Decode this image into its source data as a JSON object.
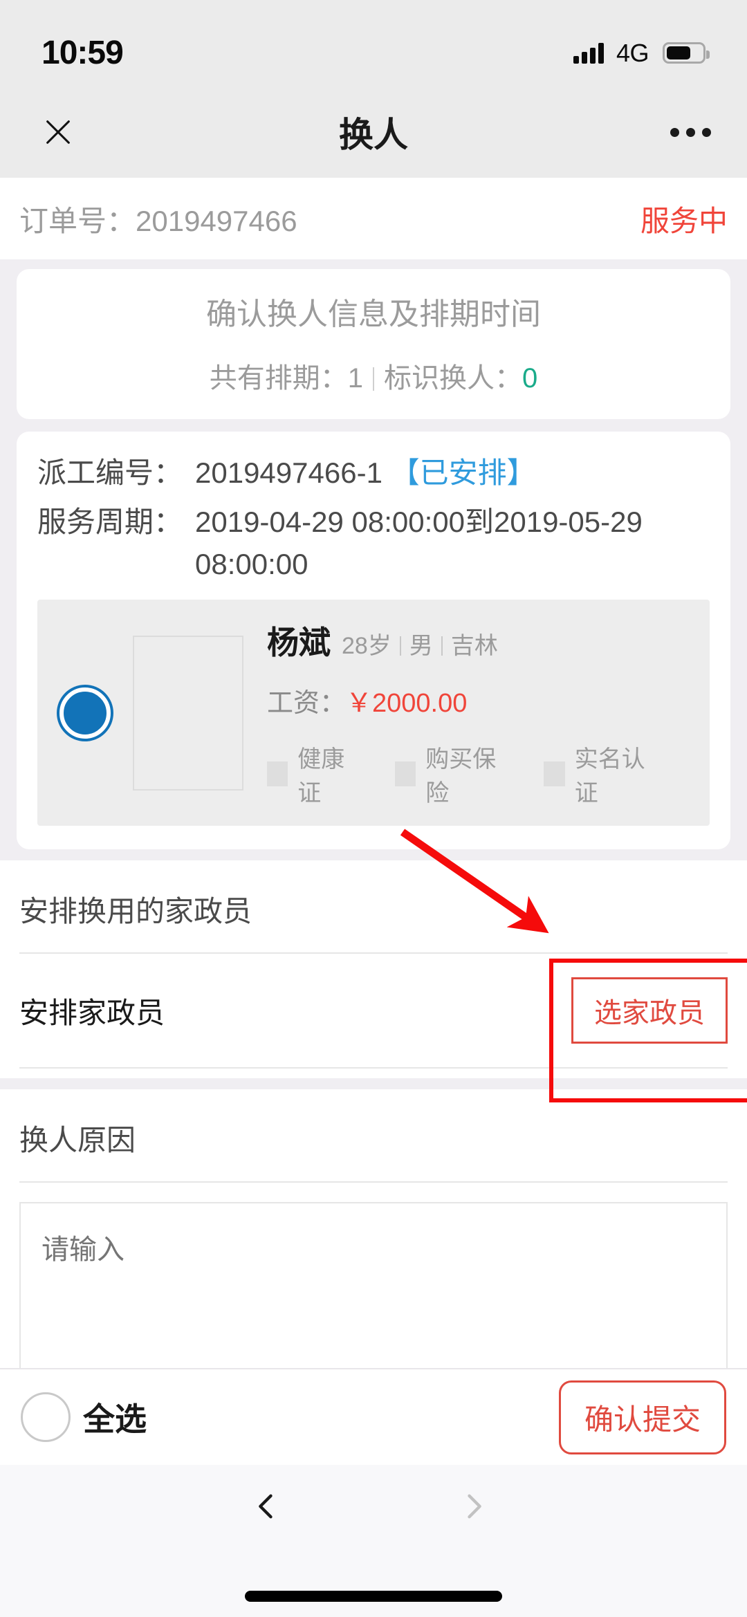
{
  "status_bar": {
    "time": "10:59",
    "network": "4G",
    "signal_icon": "signal-bars-icon",
    "battery_icon": "battery-icon",
    "battery_level_percent": 60
  },
  "nav_bar": {
    "close_icon": "close-x-icon",
    "title": "换人",
    "more_icon": "more-dots-icon"
  },
  "order": {
    "label": "订单号：",
    "number": "2019497466",
    "status": "服务中",
    "status_color": "#f0453a"
  },
  "confirm_card": {
    "title": "确认换人信息及排期时间",
    "schedule_label": "共有排期：",
    "schedule_count": "1",
    "mark_label": "标识换人：",
    "mark_count": "0",
    "mark_count_color": "#1aab8a"
  },
  "dispatch": {
    "no_label": "派工编号：",
    "no_value": "2019497466-1",
    "no_badge": "【已安排】",
    "no_badge_color": "#2f9bdd",
    "period_label": "服务周期：",
    "period_value": "2019-04-29 08:00:00到2019-05-29 08:00:00"
  },
  "worker": {
    "radio_selected": true,
    "radio_color": "#1273b8",
    "avatar_icon": "avatar-placeholder-icon",
    "name": "杨斌",
    "age": "28岁",
    "gender": "男",
    "province": "吉林",
    "salary_label": "工资：",
    "salary_value": "￥2000.00",
    "salary_color": "#f0453a",
    "tags": [
      {
        "label": "健康证",
        "icon": "health-cert-icon"
      },
      {
        "label": "购买保险",
        "icon": "insurance-icon"
      },
      {
        "label": "实名认证",
        "icon": "realname-cert-icon"
      }
    ]
  },
  "replacement_section": {
    "title": "安排换用的家政员",
    "row_label": "安排家政员",
    "pick_button": "选家政员",
    "pick_button_color": "#e04a3f"
  },
  "reason_section": {
    "title": "换人原因",
    "textarea_placeholder": "请输入",
    "textarea_value": ""
  },
  "bottom_bar": {
    "select_all_label": "全选",
    "select_all_checked": false,
    "submit_label": "确认提交",
    "submit_color": "#e04a3f"
  },
  "browser_nav": {
    "back_icon": "chevron-left-icon",
    "back_enabled": true,
    "forward_icon": "chevron-right-icon",
    "forward_enabled": false
  },
  "home_indicator": {
    "icon": "home-indicator-bar"
  },
  "annotations": {
    "highlight_color": "#f50b0b",
    "arrow_icon": "red-arrow-icon",
    "box_icon": "red-highlight-box"
  }
}
